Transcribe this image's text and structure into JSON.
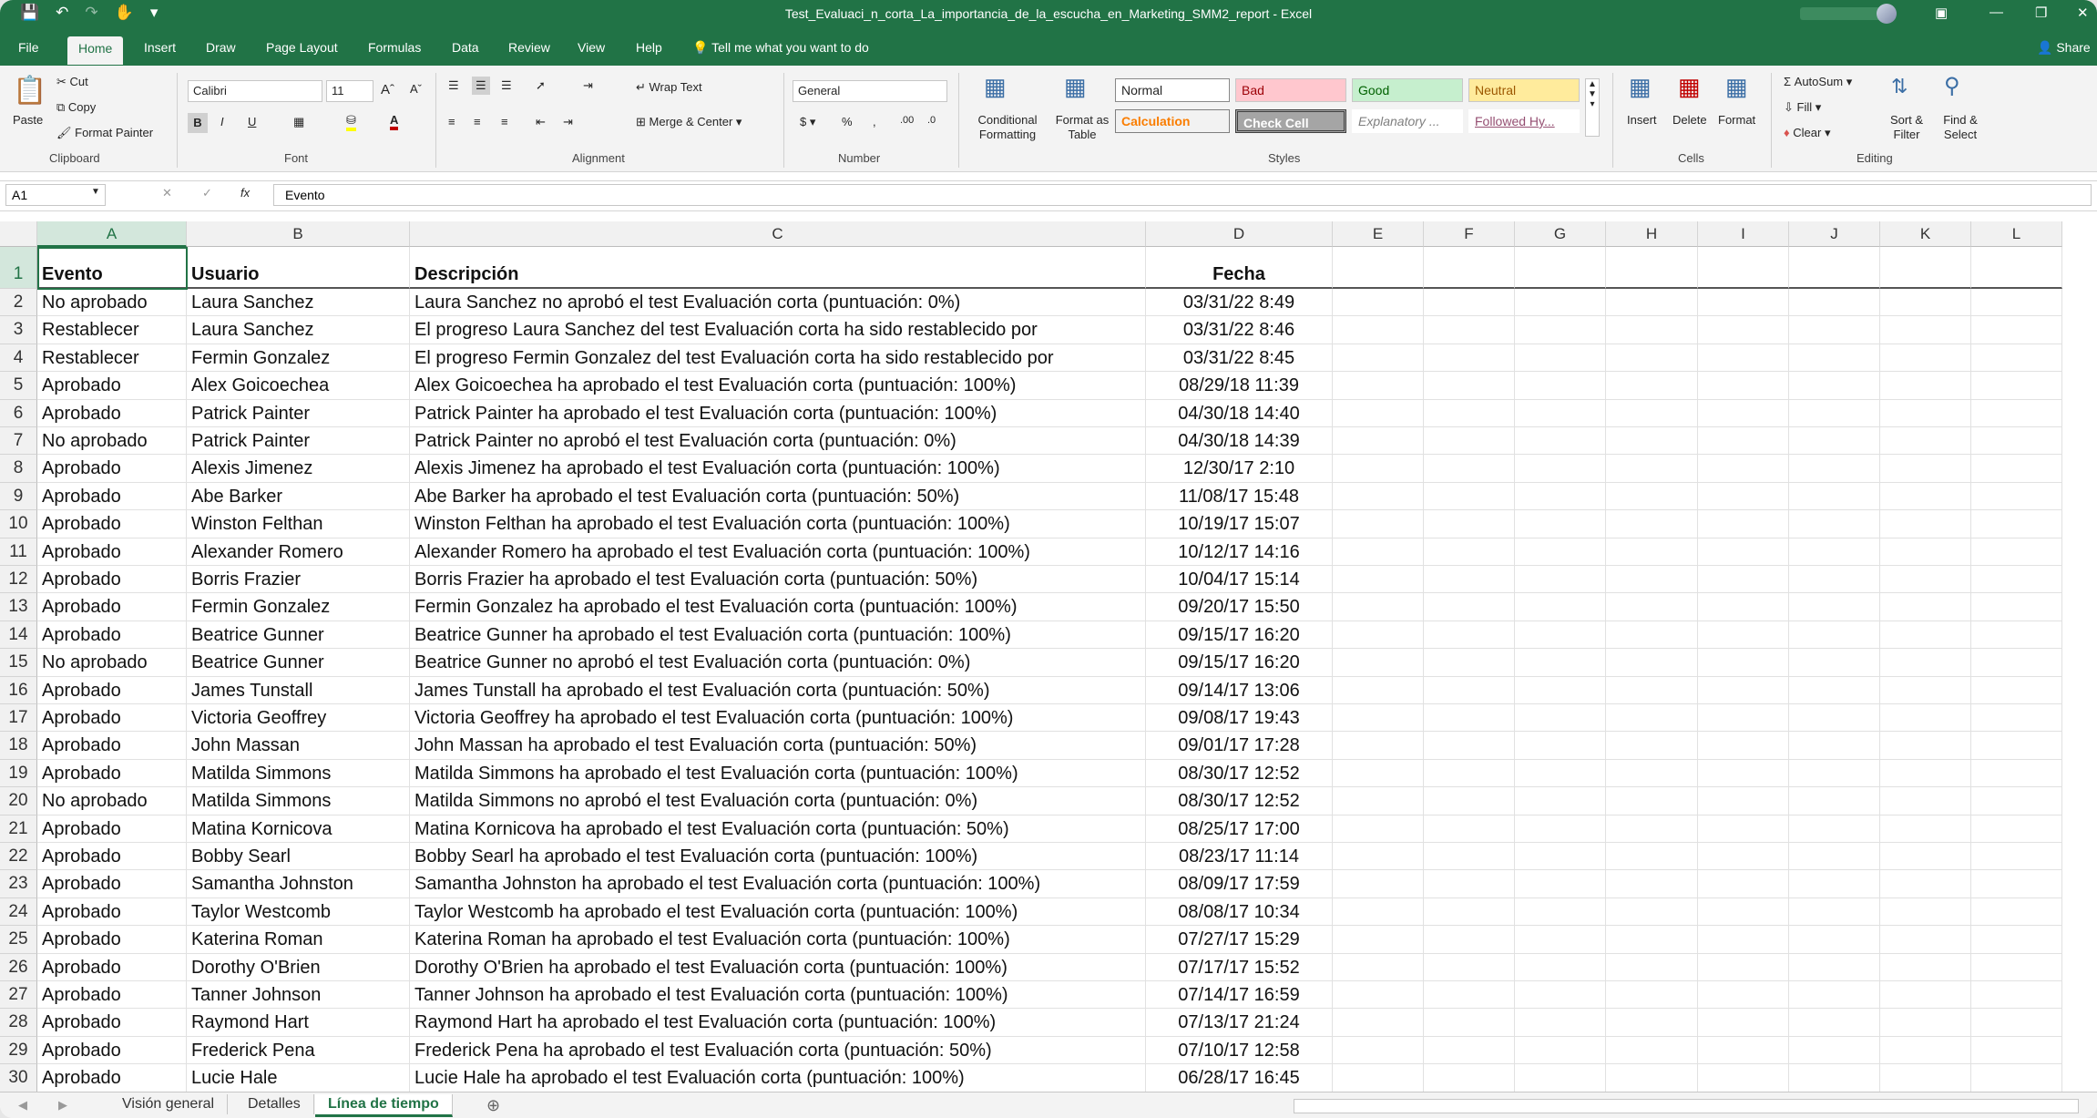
{
  "titlebar": {
    "title": "Test_Evaluaci_n_corta_La_importancia_de_la_escucha_en_Marketing_SMM2_report  -  Excel"
  },
  "tabs": [
    "File",
    "Home",
    "Insert",
    "Draw",
    "Page Layout",
    "Formulas",
    "Data",
    "Review",
    "View",
    "Help"
  ],
  "tellme": "Tell me what you want to do",
  "share": "Share",
  "ribbon": {
    "clipboard": {
      "paste": "Paste",
      "cut": "Cut",
      "copy": "Copy",
      "format_painter": "Format Painter",
      "label": "Clipboard"
    },
    "font": {
      "name": "Calibri",
      "size": "11",
      "label": "Font"
    },
    "alignment": {
      "wrap": "Wrap Text",
      "merge": "Merge & Center",
      "label": "Alignment"
    },
    "number": {
      "format": "General",
      "label": "Number"
    },
    "styles": {
      "conditional": "Conditional Formatting",
      "format_table": "Format as Table",
      "label": "Styles",
      "normal": "Normal",
      "bad": "Bad",
      "good": "Good",
      "neutral": "Neutral",
      "calculation": "Calculation",
      "check_cell": "Check Cell",
      "explanatory": "Explanatory ...",
      "followed": "Followed Hy..."
    },
    "cells": {
      "insert": "Insert",
      "delete": "Delete",
      "format": "Format",
      "label": "Cells"
    },
    "editing": {
      "autosum": "AutoSum",
      "fill": "Fill",
      "clear": "Clear",
      "sort": "Sort & Filter",
      "find": "Find & Select",
      "label": "Editing"
    }
  },
  "formula_bar": {
    "name_box": "A1",
    "value": "Evento"
  },
  "columns": [
    "A",
    "B",
    "C",
    "D",
    "E",
    "F",
    "G",
    "H",
    "I",
    "J",
    "K",
    "L"
  ],
  "sheet": {
    "headers": [
      "Evento",
      "Usuario",
      "Descripción",
      "Fecha"
    ],
    "rows": [
      [
        "No aprobado",
        "Laura Sanchez",
        "Laura Sanchez no aprobó el test Evaluación corta (puntuación: 0%)",
        "03/31/22 8:49"
      ],
      [
        "Restablecer",
        "Laura Sanchez",
        "El progreso Laura Sanchez del test Evaluación corta ha sido restablecido por",
        "03/31/22 8:46"
      ],
      [
        "Restablecer",
        "Fermin Gonzalez",
        "El progreso Fermin Gonzalez del test Evaluación corta ha sido restablecido por",
        "03/31/22 8:45"
      ],
      [
        "Aprobado",
        "Alex Goicoechea",
        "Alex Goicoechea ha aprobado el test Evaluación corta (puntuación: 100%)",
        "08/29/18 11:39"
      ],
      [
        "Aprobado",
        "Patrick Painter",
        "Patrick Painter ha aprobado el test Evaluación corta (puntuación: 100%)",
        "04/30/18 14:40"
      ],
      [
        "No aprobado",
        "Patrick Painter",
        "Patrick Painter no aprobó el test Evaluación corta (puntuación: 0%)",
        "04/30/18 14:39"
      ],
      [
        "Aprobado",
        "Alexis Jimenez",
        "Alexis Jimenez ha aprobado el test Evaluación corta (puntuación: 100%)",
        "12/30/17 2:10"
      ],
      [
        "Aprobado",
        "Abe Barker",
        "Abe Barker ha aprobado el test Evaluación corta (puntuación: 50%)",
        "11/08/17 15:48"
      ],
      [
        "Aprobado",
        "Winston Felthan",
        "Winston Felthan ha aprobado el test Evaluación corta (puntuación: 100%)",
        "10/19/17 15:07"
      ],
      [
        "Aprobado",
        "Alexander Romero",
        "Alexander Romero ha aprobado el test Evaluación corta (puntuación: 100%)",
        "10/12/17 14:16"
      ],
      [
        "Aprobado",
        "Borris Frazier",
        "Borris Frazier ha aprobado el test Evaluación corta (puntuación: 50%)",
        "10/04/17 15:14"
      ],
      [
        "Aprobado",
        "Fermin Gonzalez",
        "Fermin Gonzalez ha aprobado el test Evaluación corta (puntuación: 100%)",
        "09/20/17 15:50"
      ],
      [
        "Aprobado",
        "Beatrice Gunner",
        "Beatrice Gunner ha aprobado el test Evaluación corta (puntuación: 100%)",
        "09/15/17 16:20"
      ],
      [
        "No aprobado",
        "Beatrice Gunner",
        "Beatrice Gunner no aprobó el test Evaluación corta (puntuación: 0%)",
        "09/15/17 16:20"
      ],
      [
        "Aprobado",
        "James Tunstall",
        "James Tunstall ha aprobado el test Evaluación corta (puntuación: 50%)",
        "09/14/17 13:06"
      ],
      [
        "Aprobado",
        "Victoria Geoffrey",
        "Victoria Geoffrey ha aprobado el test Evaluación corta (puntuación: 100%)",
        "09/08/17 19:43"
      ],
      [
        "Aprobado",
        "John Massan",
        "John Massan ha aprobado el test Evaluación corta (puntuación: 50%)",
        "09/01/17 17:28"
      ],
      [
        "Aprobado",
        "Matilda Simmons",
        "Matilda Simmons ha aprobado el test Evaluación corta (puntuación: 100%)",
        "08/30/17 12:52"
      ],
      [
        "No aprobado",
        "Matilda Simmons",
        "Matilda Simmons no aprobó el test Evaluación corta (puntuación: 0%)",
        "08/30/17 12:52"
      ],
      [
        "Aprobado",
        "Matina Kornicova",
        "Matina Kornicova ha aprobado el test Evaluación corta (puntuación: 50%)",
        "08/25/17 17:00"
      ],
      [
        "Aprobado",
        "Bobby Searl",
        "Bobby Searl ha aprobado el test Evaluación corta (puntuación: 100%)",
        "08/23/17 11:14"
      ],
      [
        "Aprobado",
        "Samantha Johnston",
        "Samantha Johnston ha aprobado el test Evaluación corta (puntuación: 100%)",
        "08/09/17 17:59"
      ],
      [
        "Aprobado",
        "Taylor Westcomb",
        "Taylor Westcomb ha aprobado el test Evaluación corta (puntuación: 100%)",
        "08/08/17 10:34"
      ],
      [
        "Aprobado",
        "Katerina Roman",
        "Katerina Roman ha aprobado el test Evaluación corta (puntuación: 100%)",
        "07/27/17 15:29"
      ],
      [
        "Aprobado",
        "Dorothy O'Brien",
        "Dorothy O'Brien ha aprobado el test Evaluación corta (puntuación: 100%)",
        "07/17/17 15:52"
      ],
      [
        "Aprobado",
        "Tanner Johnson",
        "Tanner Johnson ha aprobado el test Evaluación corta (puntuación: 100%)",
        "07/14/17 16:59"
      ],
      [
        "Aprobado",
        "Raymond Hart",
        "Raymond Hart ha aprobado el test Evaluación corta (puntuación: 100%)",
        "07/13/17 21:24"
      ],
      [
        "Aprobado",
        "Frederick Pena",
        "Frederick Pena ha aprobado el test Evaluación corta (puntuación: 50%)",
        "07/10/17 12:58"
      ],
      [
        "Aprobado",
        "Lucie Hale",
        "Lucie Hale ha aprobado el test Evaluación corta (puntuación: 100%)",
        "06/28/17 16:45"
      ]
    ]
  },
  "sheet_tabs": [
    "Visión general",
    "Detalles",
    "Línea de tiempo"
  ],
  "active_sheet": "Línea de tiempo",
  "colors": {
    "accent": "#217346"
  }
}
